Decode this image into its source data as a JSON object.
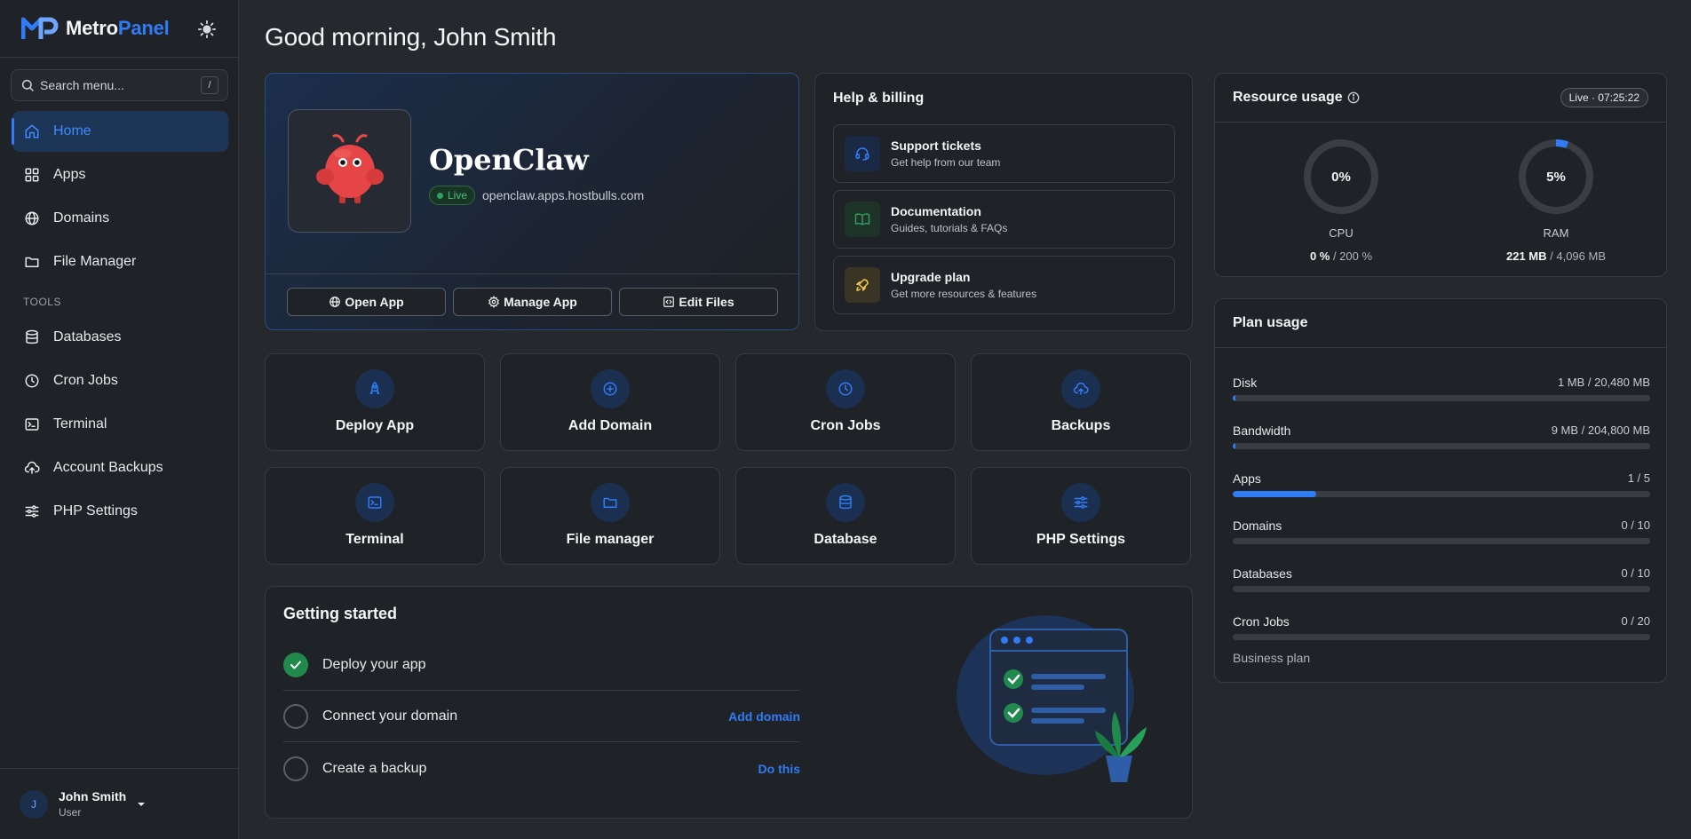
{
  "brand": {
    "part1": "Metro",
    "part2": "Panel"
  },
  "search": {
    "placeholder": "Search menu...",
    "shortcut": "/"
  },
  "sidebar": {
    "items": [
      {
        "label": "Home",
        "icon": "home-icon"
      },
      {
        "label": "Apps",
        "icon": "grid-icon"
      },
      {
        "label": "Domains",
        "icon": "globe-icon"
      },
      {
        "label": "File Manager",
        "icon": "folder-icon"
      }
    ],
    "section": "TOOLS",
    "tools": [
      {
        "label": "Databases",
        "icon": "database-icon"
      },
      {
        "label": "Cron Jobs",
        "icon": "clock-icon"
      },
      {
        "label": "Terminal",
        "icon": "terminal-icon"
      },
      {
        "label": "Account Backups",
        "icon": "cloud-upload-icon"
      },
      {
        "label": "PHP Settings",
        "icon": "sliders-icon"
      }
    ]
  },
  "user": {
    "initial": "J",
    "name": "John Smith",
    "role": "User"
  },
  "greeting": "Good morning, John Smith",
  "app": {
    "name": "OpenClaw",
    "status": "Live",
    "url": "openclaw.apps.hostbulls.com",
    "actions": [
      "Open App",
      "Manage App",
      "Edit Files"
    ]
  },
  "help": {
    "title": "Help & billing",
    "items": [
      {
        "title": "Support tickets",
        "subtitle": "Get help from our team"
      },
      {
        "title": "Documentation",
        "subtitle": "Guides, tutorials & FAQs"
      },
      {
        "title": "Upgrade plan",
        "subtitle": "Get more resources & features"
      }
    ]
  },
  "resource": {
    "title": "Resource usage",
    "badge": "Live · 07:25:22",
    "cpu": {
      "percent_text": "0%",
      "label": "CPU",
      "used": "0 %",
      "total": " / 200 %",
      "fraction": 0.0
    },
    "ram": {
      "percent_text": "5%",
      "label": "RAM",
      "used": "221 MB",
      "total": " / 4,096 MB",
      "fraction": 0.054
    }
  },
  "plan": {
    "title": "Plan usage",
    "rows": [
      {
        "label": "Disk",
        "value": "1 MB / 20,480 MB",
        "fraction": 5e-05
      },
      {
        "label": "Bandwidth",
        "value": "9 MB / 204,800 MB",
        "fraction": 4e-05
      },
      {
        "label": "Apps",
        "value": "1 / 5",
        "fraction": 0.2
      },
      {
        "label": "Domains",
        "value": "0 / 10",
        "fraction": 0
      },
      {
        "label": "Databases",
        "value": "0 / 10",
        "fraction": 0
      },
      {
        "label": "Cron Jobs",
        "value": "0 / 20",
        "fraction": 0
      }
    ],
    "note": "Business plan"
  },
  "quick_actions": [
    {
      "label": "Deploy App",
      "icon": "rocket-icon"
    },
    {
      "label": "Add Domain",
      "icon": "plus-circle-icon"
    },
    {
      "label": "Cron Jobs",
      "icon": "clock-icon"
    },
    {
      "label": "Backups",
      "icon": "cloud-upload-icon"
    },
    {
      "label": "Terminal",
      "icon": "terminal-icon"
    },
    {
      "label": "File manager",
      "icon": "folder-icon"
    },
    {
      "label": "Database",
      "icon": "database-icon"
    },
    {
      "label": "PHP Settings",
      "icon": "sliders-icon"
    }
  ],
  "getting_started": {
    "title": "Getting started",
    "steps": [
      {
        "label": "Deploy your app",
        "done": true,
        "action": ""
      },
      {
        "label": "Connect your domain",
        "done": false,
        "action": "Add domain"
      },
      {
        "label": "Create a backup",
        "done": false,
        "action": "Do this"
      }
    ]
  },
  "colors": {
    "accent": "#2f7cf6",
    "success": "#1f8a4c",
    "background": "#25282c",
    "card": "#1f2226"
  }
}
